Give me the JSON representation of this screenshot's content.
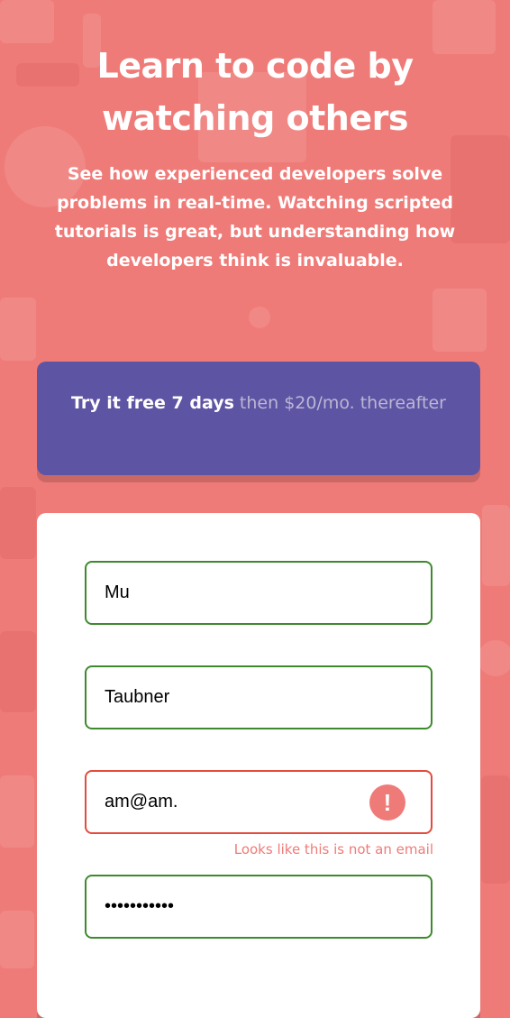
{
  "hero": {
    "title": "Learn to code by watching others",
    "description": "See how experienced developers solve problems in real-time. Watching scripted tutorials is great, but understanding how developers think is invaluable."
  },
  "promo": {
    "bold_text": "Try it free 7 days",
    "light_text": " then $20/mo. thereafter"
  },
  "form": {
    "first_name": "Mu",
    "last_name": "Taubner",
    "email": "am@am.",
    "email_error": "Looks like this is not an email",
    "password": "•••••••••••",
    "error_icon": "!"
  },
  "colors": {
    "background": "#ef7b78",
    "promo": "#5e54a4",
    "valid_border": "#3d8a2d",
    "error": "#e24b3d"
  }
}
